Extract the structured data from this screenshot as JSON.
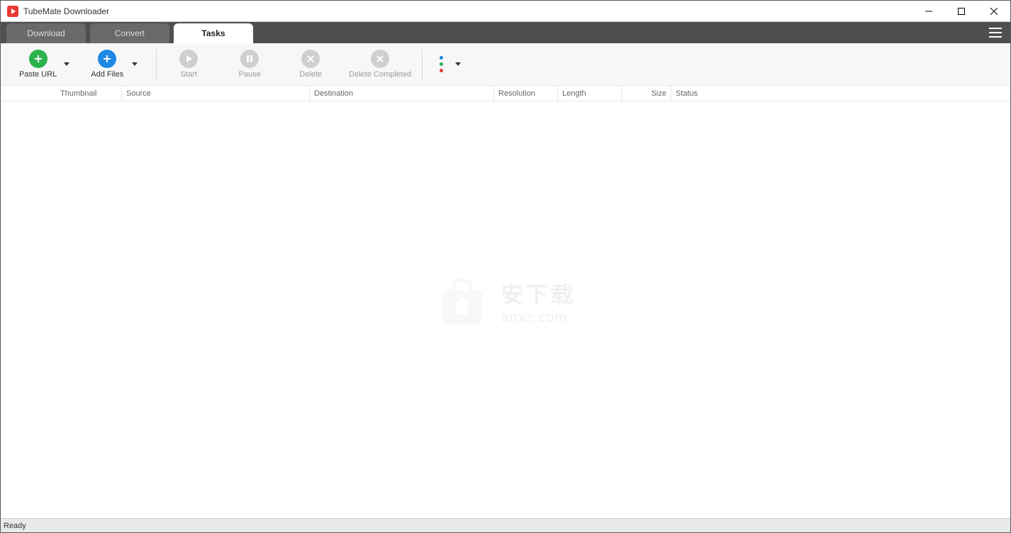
{
  "window": {
    "title": "TubeMate Downloader"
  },
  "tabs": [
    {
      "label": "Download",
      "active": false
    },
    {
      "label": "Convert",
      "active": false
    },
    {
      "label": "Tasks",
      "active": true
    }
  ],
  "toolbar": {
    "paste_url": "Paste URL",
    "add_files": "Add Files",
    "start": "Start",
    "pause": "Pause",
    "delete": "Delete",
    "delete_completed": "Delete Completed"
  },
  "columns": {
    "thumbnail": "Thumbnail",
    "source": "Source",
    "destination": "Destination",
    "resolution": "Resolution",
    "length": "Length",
    "size": "Size",
    "status": "Status"
  },
  "watermark": {
    "cn": "安下载",
    "en": "anxz.com"
  },
  "status": {
    "text": "Ready"
  }
}
